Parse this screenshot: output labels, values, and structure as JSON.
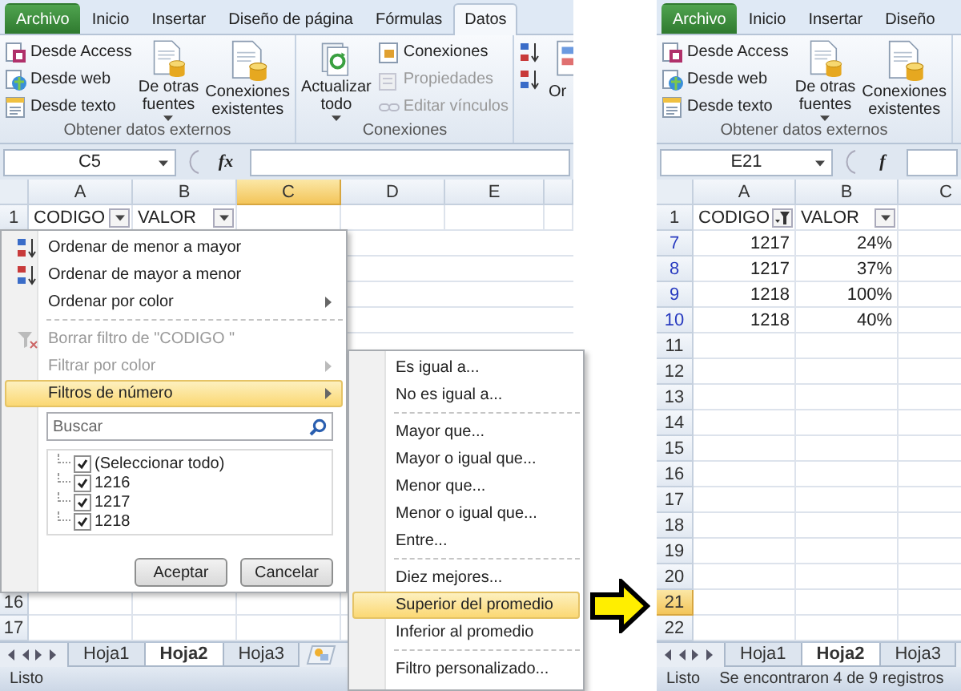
{
  "left": {
    "tabs": [
      {
        "label": "Archivo",
        "kind": "file",
        "selected": false
      },
      {
        "label": "Inicio",
        "kind": "tab",
        "selected": false
      },
      {
        "label": "Insertar",
        "kind": "tab",
        "selected": false
      },
      {
        "label": "Diseño de página",
        "kind": "tab",
        "selected": false
      },
      {
        "label": "Fórmulas",
        "kind": "tab",
        "selected": false
      },
      {
        "label": "Datos",
        "kind": "tab",
        "selected": true
      }
    ],
    "groups": [
      {
        "label": "Obtener datos externos",
        "items": [
          {
            "kind": "stack",
            "buttons": [
              {
                "label": "Desde Access",
                "disabled": false
              },
              {
                "label": "Desde web",
                "disabled": false
              },
              {
                "label": "Desde texto",
                "disabled": false
              }
            ]
          },
          {
            "kind": "large",
            "lines": [
              "De otras",
              "fuentes"
            ],
            "dropdown": true
          },
          {
            "kind": "large",
            "lines": [
              "Conexiones",
              "existentes"
            ],
            "dropdown": false
          }
        ]
      },
      {
        "label": "Conexiones",
        "items": [
          {
            "kind": "large",
            "lines": [
              "Actualizar",
              "todo"
            ],
            "dropdown": true
          },
          {
            "kind": "stack",
            "buttons": [
              {
                "label": "Conexiones",
                "disabled": false
              },
              {
                "label": "Propiedades",
                "disabled": true
              },
              {
                "label": "Editar vínculos",
                "disabled": true
              }
            ]
          }
        ]
      },
      {
        "items": [
          {
            "kind": "stack",
            "buttons": [
              {
                "disabled": false
              },
              {
                "disabled": false
              }
            ]
          },
          {
            "kind": "large",
            "lines": [
              "Or"
            ]
          }
        ]
      }
    ],
    "name_box": "C5",
    "fx": "fx",
    "columns": [
      {
        "label": "A",
        "selected": false
      },
      {
        "label": "B",
        "selected": false
      },
      {
        "label": "C",
        "selected": true
      },
      {
        "label": "D",
        "selected": false
      },
      {
        "label": "E",
        "selected": false
      }
    ],
    "rows": [
      {
        "num": "1",
        "selected": false,
        "filtered": false,
        "cells": [
          {
            "text": "CODIGO",
            "kind": "header",
            "filter_applied": false
          },
          {
            "text": "VALOR",
            "kind": "header",
            "filter_applied": false
          }
        ]
      },
      {
        "num": "16",
        "selected": false,
        "filtered": false,
        "cells": []
      },
      {
        "num": "17",
        "selected": false,
        "filtered": false,
        "cells": []
      }
    ],
    "sheets": [
      {
        "label": "Hoja1",
        "selected": false
      },
      {
        "label": "Hoja2",
        "selected": true
      },
      {
        "label": "Hoja3",
        "selected": false
      }
    ],
    "status": [
      "Listo"
    ]
  },
  "filter_menu": {
    "items": [
      {
        "kind": "item",
        "label": "Ordenar de menor a mayor",
        "submenu": false,
        "disabled": false,
        "selected": false
      },
      {
        "kind": "item",
        "label": "Ordenar de mayor a menor",
        "submenu": false,
        "disabled": false,
        "selected": false
      },
      {
        "kind": "item",
        "label": "Ordenar por color",
        "submenu": true,
        "disabled": false,
        "selected": false
      },
      {
        "kind": "separator"
      },
      {
        "kind": "item",
        "label": "Borrar filtro de \"CODIGO  \"",
        "submenu": false,
        "disabled": true,
        "selected": false
      },
      {
        "kind": "item",
        "label": "Filtrar por color",
        "submenu": true,
        "disabled": true,
        "selected": false
      },
      {
        "kind": "item",
        "label": "Filtros de número",
        "submenu": true,
        "disabled": false,
        "selected": true
      }
    ],
    "search": {
      "placeholder": "Buscar"
    },
    "values": [
      {
        "label": "(Seleccionar todo)",
        "checked": true
      },
      {
        "label": "1216",
        "checked": true
      },
      {
        "label": "1217",
        "checked": true
      },
      {
        "label": "1218",
        "checked": true
      }
    ],
    "buttons": [
      "Aceptar",
      "Cancelar"
    ]
  },
  "number_filters": {
    "items": [
      {
        "kind": "item",
        "label": "Es igual a...",
        "selected": false
      },
      {
        "kind": "item",
        "label": "No es igual a...",
        "selected": false
      },
      {
        "kind": "separator"
      },
      {
        "kind": "item",
        "label": "Mayor que...",
        "selected": false
      },
      {
        "kind": "item",
        "label": "Mayor o igual que...",
        "selected": false
      },
      {
        "kind": "item",
        "label": "Menor que...",
        "selected": false
      },
      {
        "kind": "item",
        "label": "Menor o igual que...",
        "selected": false
      },
      {
        "kind": "item",
        "label": "Entre...",
        "selected": false
      },
      {
        "kind": "separator"
      },
      {
        "kind": "item",
        "label": "Diez mejores...",
        "selected": false
      },
      {
        "kind": "item",
        "label": "Superior del promedio",
        "selected": true
      },
      {
        "kind": "item",
        "label": "Inferior al promedio",
        "selected": false
      },
      {
        "kind": "separator"
      },
      {
        "kind": "item",
        "label": "Filtro personalizado...",
        "selected": false
      }
    ]
  },
  "right": {
    "tabs": [
      {
        "label": "Archivo",
        "kind": "file",
        "selected": false
      },
      {
        "label": "Inicio",
        "kind": "tab",
        "selected": false
      },
      {
        "label": "Insertar",
        "kind": "tab",
        "selected": false
      },
      {
        "label": "Diseño",
        "kind": "tab",
        "selected": false
      }
    ],
    "groups": [
      {
        "label": "Obtener datos externos",
        "items": [
          {
            "kind": "stack",
            "buttons": [
              {
                "label": "Desde Access",
                "disabled": false
              },
              {
                "label": "Desde web",
                "disabled": false
              },
              {
                "label": "Desde texto",
                "disabled": false
              }
            ]
          },
          {
            "kind": "large",
            "lines": [
              "De otras",
              "fuentes"
            ],
            "dropdown": true
          },
          {
            "kind": "large",
            "lines": [
              "Conexiones",
              "existentes"
            ],
            "dropdown": false
          }
        ]
      }
    ],
    "name_box": "E21",
    "fx": "f",
    "columns": [
      {
        "label": "A",
        "selected": false
      },
      {
        "label": "B",
        "selected": false
      },
      {
        "label": "C",
        "selected": false
      }
    ],
    "rows": [
      {
        "num": "1",
        "selected": false,
        "filtered": false,
        "cells": [
          {
            "text": "CODIGO",
            "kind": "header",
            "filter_applied": true
          },
          {
            "text": "VALOR",
            "kind": "header",
            "filter_applied": false
          }
        ]
      },
      {
        "num": "7",
        "selected": false,
        "filtered": true,
        "cells": [
          {
            "text": "1217",
            "kind": "number"
          },
          {
            "text": "24%",
            "kind": "number"
          }
        ]
      },
      {
        "num": "8",
        "selected": false,
        "filtered": true,
        "cells": [
          {
            "text": "1217",
            "kind": "number"
          },
          {
            "text": "37%",
            "kind": "number"
          }
        ]
      },
      {
        "num": "9",
        "selected": false,
        "filtered": true,
        "cells": [
          {
            "text": "1218",
            "kind": "number"
          },
          {
            "text": "100%",
            "kind": "number"
          }
        ]
      },
      {
        "num": "10",
        "selected": false,
        "filtered": true,
        "cells": [
          {
            "text": "1218",
            "kind": "number"
          },
          {
            "text": "40%",
            "kind": "number"
          }
        ]
      },
      {
        "num": "11",
        "selected": false,
        "filtered": false,
        "cells": []
      },
      {
        "num": "12",
        "selected": false,
        "filtered": false,
        "cells": []
      },
      {
        "num": "13",
        "selected": false,
        "filtered": false,
        "cells": []
      },
      {
        "num": "14",
        "selected": false,
        "filtered": false,
        "cells": []
      },
      {
        "num": "15",
        "selected": false,
        "filtered": false,
        "cells": []
      },
      {
        "num": "16",
        "selected": false,
        "filtered": false,
        "cells": []
      },
      {
        "num": "17",
        "selected": false,
        "filtered": false,
        "cells": []
      },
      {
        "num": "18",
        "selected": false,
        "filtered": false,
        "cells": []
      },
      {
        "num": "19",
        "selected": false,
        "filtered": false,
        "cells": []
      },
      {
        "num": "20",
        "selected": false,
        "filtered": false,
        "cells": []
      },
      {
        "num": "21",
        "selected": true,
        "filtered": false,
        "cells": []
      },
      {
        "num": "22",
        "selected": false,
        "filtered": false,
        "cells": []
      }
    ],
    "sheets": [
      {
        "label": "Hoja1",
        "selected": false
      },
      {
        "label": "Hoja2",
        "selected": true
      },
      {
        "label": "Hoja3",
        "selected": false
      }
    ],
    "status": [
      "Listo",
      "Se encontraron 4 de 9 registros"
    ]
  }
}
